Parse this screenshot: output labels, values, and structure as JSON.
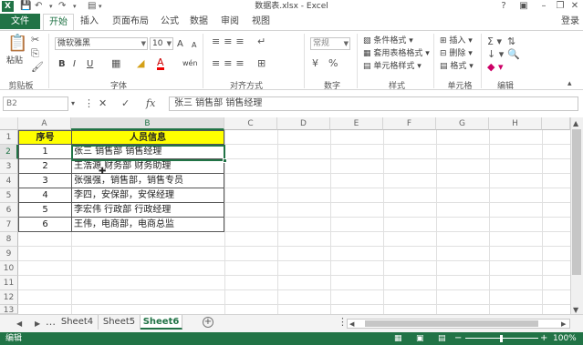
{
  "window": {
    "title": "数据表.xlsx - Excel",
    "help": "?",
    "login": "登录"
  },
  "tabs": [
    "文件",
    "开始",
    "插入",
    "页面布局",
    "公式",
    "数据",
    "审阅",
    "视图"
  ],
  "ribbon": {
    "clipboard": {
      "label": "剪贴板",
      "paste": "粘贴"
    },
    "font": {
      "label": "字体",
      "name": "微软雅黑",
      "size": "10",
      "bold": "B",
      "italic": "I",
      "underline": "U",
      "font_color": "A",
      "grow": "A",
      "shrink": "A",
      "phonetic": "wén"
    },
    "alignment": {
      "label": "对齐方式"
    },
    "number": {
      "label": "数字",
      "format": "常规"
    },
    "styles": {
      "label": "样式",
      "cond": "条件格式",
      "table": "套用表格格式",
      "cell": "单元格样式"
    },
    "cells": {
      "label": "单元格",
      "insert": "插入",
      "delete": "删除",
      "format": "格式"
    },
    "editing": {
      "label": "编辑"
    }
  },
  "formula_bar": {
    "name_box": "B2",
    "fx": "fx",
    "value": "张三  销售部  销售经理"
  },
  "columns": [
    "A",
    "B",
    "C",
    "D",
    "E",
    "F",
    "G",
    "H"
  ],
  "rows": [
    "1",
    "2",
    "3",
    "4",
    "5",
    "6",
    "7",
    "8",
    "9",
    "10",
    "11",
    "12",
    "13"
  ],
  "table": {
    "headers": [
      "序号",
      "人员信息"
    ],
    "rows": [
      [
        "1",
        "张三  销售部  销售经理"
      ],
      [
        "2",
        "王浩源 财务部 财务助理"
      ],
      [
        "3",
        "张强强，销售部，销售专员"
      ],
      [
        "4",
        "李四，安保部，安保经理"
      ],
      [
        "5",
        "李宏伟  行政部  行政经理"
      ],
      [
        "6",
        "王伟，电商部，电商总监"
      ]
    ]
  },
  "sheets": [
    "Sheet4",
    "Sheet5",
    "Sheet6"
  ],
  "active_sheet": "Sheet6",
  "status": {
    "mode": "编辑",
    "zoom": "100%"
  },
  "colors": {
    "accent": "#217346",
    "header_fill": "#ffff00"
  }
}
